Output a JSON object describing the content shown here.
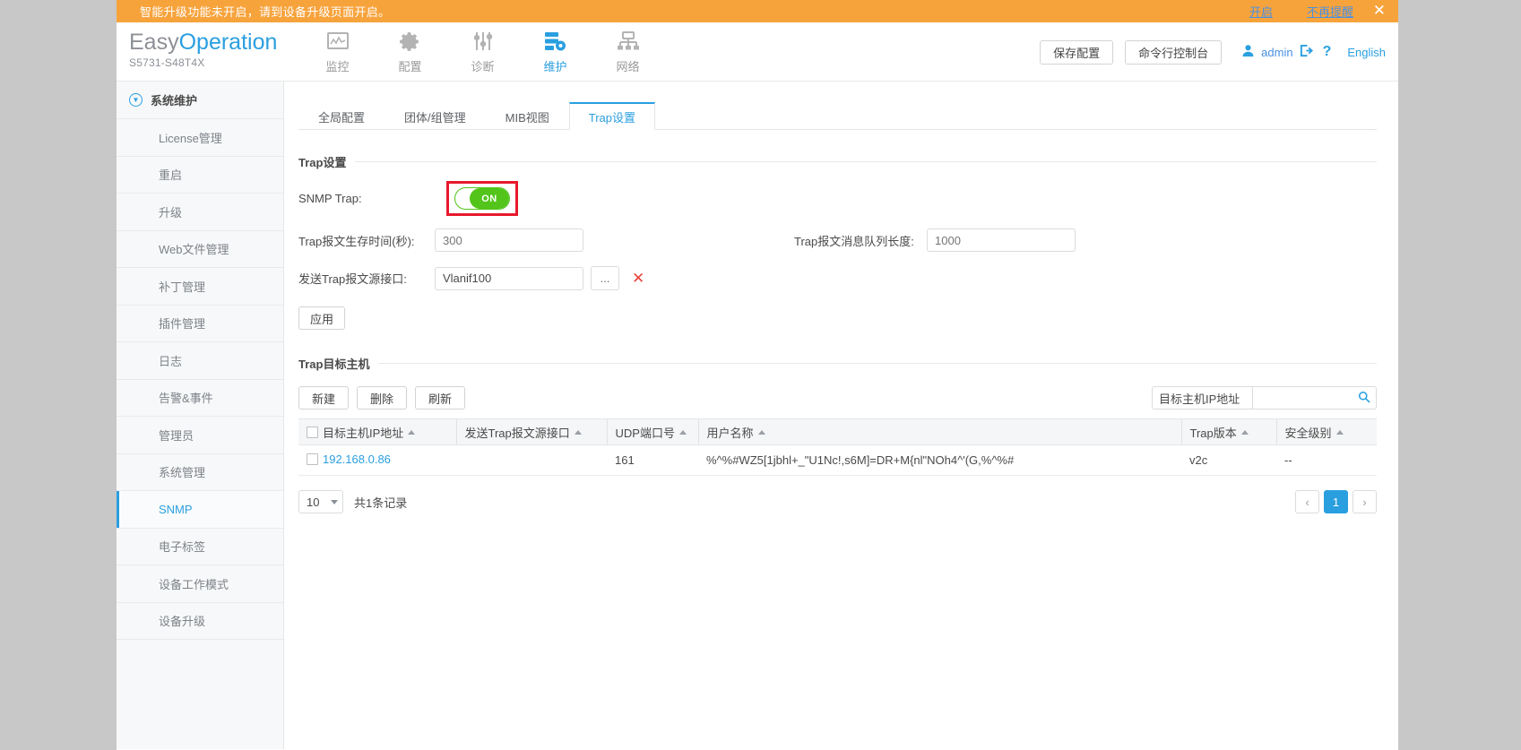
{
  "notice": {
    "text": "智能升级功能未开启，请到设备升级页面开启。",
    "enable_link": "开启",
    "dismiss_link": "不再提醒",
    "close_icon": "close-icon",
    "bg_color": "#f7a33c",
    "link_color": "#4a90e2"
  },
  "header": {
    "brand_easy": "Easy",
    "brand_operation": "Operation",
    "model": "S5731-S48T4X",
    "nav": [
      {
        "label": "监控",
        "icon": "monitor-icon",
        "active": false
      },
      {
        "label": "配置",
        "icon": "gear-icon",
        "active": false
      },
      {
        "label": "诊断",
        "icon": "sliders-icon",
        "active": false
      },
      {
        "label": "维护",
        "icon": "server-gear-icon",
        "active": true
      },
      {
        "label": "网络",
        "icon": "network-topology-icon",
        "active": false
      }
    ],
    "save_config_label": "保存配置",
    "cli_console_label": "命令行控制台",
    "user_icon": "user-icon",
    "user_name": "admin",
    "logout_icon": "logout-icon",
    "help_label": "?",
    "language_label": "English",
    "accent_color": "#2a9fe0"
  },
  "sidebar": {
    "title": "系统维护",
    "collapse_icon": "circle-chevron-down-icon",
    "items": [
      {
        "label": "License管理",
        "active": false
      },
      {
        "label": "重启",
        "active": false
      },
      {
        "label": "升级",
        "active": false
      },
      {
        "label": "Web文件管理",
        "active": false
      },
      {
        "label": "补丁管理",
        "active": false
      },
      {
        "label": "插件管理",
        "active": false
      },
      {
        "label": "日志",
        "active": false
      },
      {
        "label": "告警&事件",
        "active": false
      },
      {
        "label": "管理员",
        "active": false
      },
      {
        "label": "系统管理",
        "active": false
      },
      {
        "label": "SNMP",
        "active": true
      },
      {
        "label": "电子标签",
        "active": false
      },
      {
        "label": "设备工作模式",
        "active": false
      },
      {
        "label": "设备升级",
        "active": false
      }
    ]
  },
  "tabs": [
    {
      "label": "全局配置",
      "active": false
    },
    {
      "label": "团体/组管理",
      "active": false
    },
    {
      "label": "MIB视图",
      "active": false
    },
    {
      "label": "Trap设置",
      "active": true
    }
  ],
  "trap_settings": {
    "section_title": "Trap设置",
    "snmp_trap_label": "SNMP Trap:",
    "snmp_trap_state": "ON",
    "snmp_trap_highlight_color": "#e8192c",
    "snmp_trap_on_color": "#52c41a",
    "lifetime_label": "Trap报文生存时间(秒):",
    "lifetime_placeholder": "300",
    "lifetime_value": "",
    "queue_label": "Trap报文消息队列长度:",
    "queue_placeholder": "1000",
    "queue_value": "",
    "source_if_label": "发送Trap报文源接口:",
    "source_if_value": "Vlanif100",
    "browse_label": "...",
    "clear_icon": "close-x-icon",
    "apply_label": "应用"
  },
  "trap_hosts": {
    "section_title": "Trap目标主机",
    "create_label": "新建",
    "delete_label": "删除",
    "refresh_label": "刷新",
    "search_field_label": "目标主机IP地址",
    "search_placeholder": "",
    "search_value": "",
    "search_icon": "search-icon",
    "columns": [
      {
        "label": "目标主机IP地址",
        "sort": "asc"
      },
      {
        "label": "发送Trap报文源接口",
        "sort": "asc"
      },
      {
        "label": "UDP端口号",
        "sort": "asc"
      },
      {
        "label": "用户名称",
        "sort": "asc"
      },
      {
        "label": "Trap版本",
        "sort": "asc"
      },
      {
        "label": "安全级别",
        "sort": "asc"
      }
    ],
    "rows": [
      {
        "checked": false,
        "ip": "192.168.0.86",
        "source_interface": "",
        "udp_port": "161",
        "user_name": "%^%#WZ5[1jbhl+_\"U1Nc!,s6M]=DR+M{nl\"NOh4^'(G,%^%#",
        "trap_version": "v2c",
        "security_level": "--"
      }
    ],
    "pager": {
      "page_size": "10",
      "total_text": "共1条记录",
      "prev_icon": "chevron-left-icon",
      "next_icon": "chevron-right-icon",
      "current_page": "1"
    }
  }
}
